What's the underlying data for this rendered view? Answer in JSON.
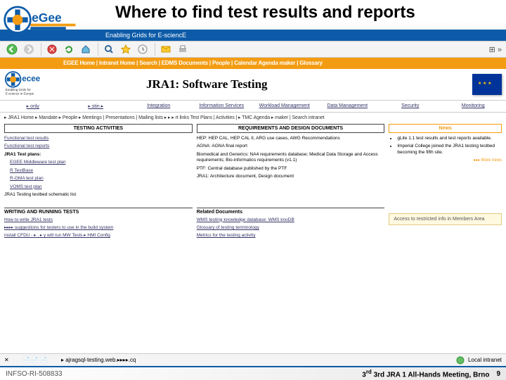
{
  "slide": {
    "title": "Where to find test results and reports",
    "subtitle": "Enabling Grids for E-sciencE",
    "footer_left": "INFSO-RI-508833",
    "footer_right": "3rd JRA 1 All-Hands Meeting, Brno",
    "page_num": "9"
  },
  "browser": {
    "flag_label": "⊞ »",
    "status_path": "▸ ajragsql-testing.web.▸▸▸▸.cq",
    "zone_label": "Local intranet"
  },
  "page": {
    "orange_nav": "EGEE Home | Intranet Home | Search | EDMS Documents | People | Calendar Agenda maker | Glossary",
    "logo_caption": "Enabling Grids for E-science in Europe",
    "heading": "JRA1: Software Testing",
    "nav_links": [
      "▸ only",
      "▸ stin ▸",
      "Integration",
      "Information Services",
      "Workload Management",
      "Data Management",
      "Security",
      "Monitoring"
    ],
    "crumbs": "▸ JRA1 Home ▸ Mandate ▸ People ▸ Meetings | Presentations | Mailing lists ▸ ▸ ▸ rt links Test Plans | Activities | ▸ TMC Agenda ▸ maker | Search intranet"
  },
  "col1": {
    "title": "TESTING ACTIVITIES",
    "items": [
      {
        "label": "Functional test results",
        "cls": "lnk"
      },
      {
        "label": "Functional test reports",
        "cls": "lnk"
      },
      {
        "label": "JRA1 Test plans:",
        "cls": ""
      },
      {
        "label": "EGEE Middleware test plan",
        "cls": "lnk indent"
      },
      {
        "label": "R TestBase",
        "cls": "lnk indent"
      },
      {
        "label": "R-GMA test plan",
        "cls": "lnk indent"
      },
      {
        "label": "VOMS test plan",
        "cls": "lnk indent"
      },
      {
        "label": "JRA1 Testing testbed   schematic   list",
        "cls": ""
      }
    ]
  },
  "col2": {
    "title": "REQUIREMENTS AND DESIGN DOCUMENTS",
    "items": [
      "HEP: HEP CAL, HEP CAL II, ARG use cases, AWG Recommendations",
      "AGNA: AGNA final report",
      "Biomedical and Generics: NA4 requirements database; Medical Data Storage and Access requirements; Bio-informatics requirements (v1.1)",
      "PTF: Central database published by the PTF",
      "JRA1: Architecture document, Design document"
    ]
  },
  "col3": {
    "title": "News",
    "bullets": [
      "gLite 1.1 test results and test reports available.",
      "Imperial College joined the JRA1 testing testbed becoming the fifth site."
    ],
    "more": "▸▸▸ More news"
  },
  "s2a": {
    "title": "WRITING AND RUNNING TESTS",
    "rows": [
      "How to write JRA1 tests",
      "▸▸▸▸ suggestions for testers to use in the build system",
      "install CFDU - ▸ . ▸ y will run MW Tests ▸ HMI Config"
    ]
  },
  "s2b": {
    "title": "Related Documents",
    "rows": [
      "WMS testing knowledge database: WMS knoDB",
      "Glossary of testing terminology",
      "Metrics for the testing activity"
    ]
  },
  "members": "Access to restricted info in Members Area"
}
